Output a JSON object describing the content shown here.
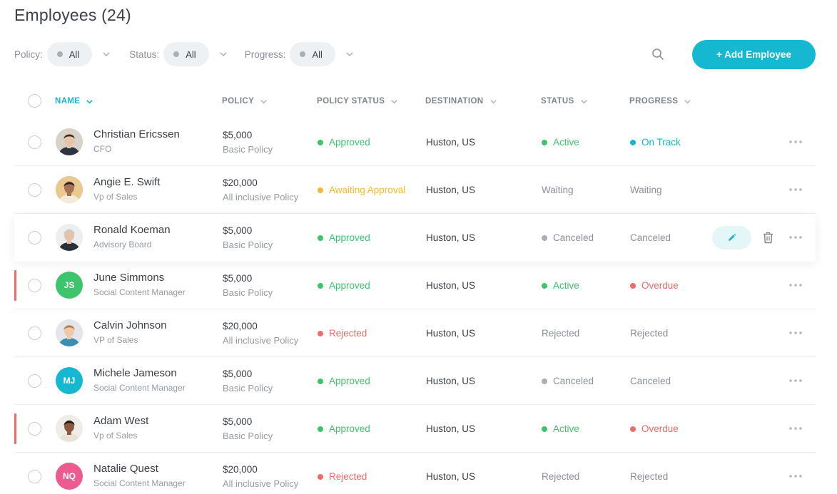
{
  "page": {
    "title": "Employees (24)"
  },
  "filters": [
    {
      "label": "Policy:",
      "value": "All"
    },
    {
      "label": "Status:",
      "value": "All"
    },
    {
      "label": "Progress:",
      "value": "All"
    }
  ],
  "actions": {
    "add_employee": "+ Add Employee",
    "search_icon": "search-icon"
  },
  "columns": [
    "NAME",
    "POLICY",
    "POLICY STATUS",
    "DESTINATION",
    "STATUS",
    "PROGRESS"
  ],
  "colors": {
    "accent": "#16b8d1",
    "green": "#3ec46d",
    "orange": "#f5b63e",
    "red": "#ef6a6a",
    "gray": "#a9afb5",
    "muted_text": "#8a9097"
  },
  "rows": [
    {
      "name": "Christian Ericssen",
      "role": "CFO",
      "amount": "$5,000",
      "policy": "Basic Policy",
      "policy_status": "Approved",
      "policy_status_color": "green",
      "destination": "Huston, US",
      "status": "Active",
      "status_dot": "green",
      "progress": "On Track",
      "progress_dot": "accent",
      "avatar": {
        "type": "photo",
        "bg": "#d9d2c8",
        "hair": "#3b2a20",
        "skin": "#e8c4a6",
        "shirt": "#2d3440"
      },
      "flag": false
    },
    {
      "name": "Angie E. Swift",
      "role": "Vp of Sales",
      "amount": "$20,000",
      "policy": "All inclusive Policy",
      "policy_status": "Awaiting Approval",
      "policy_status_color": "orange",
      "destination": "Huston, US",
      "status": "Waiting",
      "status_dot": "",
      "progress": "Waiting",
      "progress_dot": "",
      "avatar": {
        "type": "photo",
        "bg": "#e9c98f",
        "hair": "#2a1f1a",
        "skin": "#a57257",
        "shirt": "#f3ead8"
      },
      "flag": false
    },
    {
      "name": "Ronald Koeman",
      "role": "Advisory Board",
      "amount": "$5,000",
      "policy": "Basic Policy",
      "policy_status": "Approved",
      "policy_status_color": "green",
      "destination": "Huston, US",
      "status": "Canceled",
      "status_dot": "gray",
      "progress": "Canceled",
      "progress_dot": "",
      "avatar": {
        "type": "photo",
        "bg": "#eceef0",
        "hair": "#c9c9c9",
        "skin": "#e6c2aa",
        "shirt": "#2b2f38"
      },
      "flag": false,
      "hover": true
    },
    {
      "name": "June Simmons",
      "role": "Social Content Manager",
      "amount": "$5,000",
      "policy": "Basic Policy",
      "policy_status": "Approved",
      "policy_status_color": "green",
      "destination": "Huston, US",
      "status": "Active",
      "status_dot": "green",
      "progress": "Overdue",
      "progress_dot": "red",
      "avatar": {
        "type": "initials",
        "text": "JS",
        "bg": "#3ec46d"
      },
      "flag": true
    },
    {
      "name": "Calvin Johnson",
      "role": "VP of Sales",
      "amount": "$20,000",
      "policy": "All inclusive Policy",
      "policy_status": "Rejected",
      "policy_status_color": "red",
      "destination": "Huston, US",
      "status": "Rejected",
      "status_dot": "",
      "progress": "Rejected",
      "progress_dot": "",
      "avatar": {
        "type": "photo",
        "bg": "#e4e6e9",
        "hair": "#b8754a",
        "skin": "#f0c9a8",
        "shirt": "#3a8fb0"
      },
      "flag": false
    },
    {
      "name": "Michele Jameson",
      "role": "Social Content Manager",
      "amount": "$5,000",
      "policy": "Basic Policy",
      "policy_status": "Approved",
      "policy_status_color": "green",
      "destination": "Huston, US",
      "status": "Canceled",
      "status_dot": "gray",
      "progress": "Canceled",
      "progress_dot": "",
      "avatar": {
        "type": "initials",
        "text": "MJ",
        "bg": "#16b8d1"
      },
      "flag": false
    },
    {
      "name": "Adam West",
      "role": "Vp of Sales",
      "amount": "$5,000",
      "policy": "Basic Policy",
      "policy_status": "Approved",
      "policy_status_color": "green",
      "destination": "Huston, US",
      "status": "Active",
      "status_dot": "green",
      "progress": "Overdue",
      "progress_dot": "red",
      "avatar": {
        "type": "photo",
        "bg": "#f0ede8",
        "hair": "#1f1a17",
        "skin": "#8a5a40",
        "shirt": "#e8e2d8"
      },
      "flag": true
    },
    {
      "name": "Natalie Quest",
      "role": "Social Content Manager",
      "amount": "$20,000",
      "policy": "All inclusive Policy",
      "policy_status": "Rejected",
      "policy_status_color": "red",
      "destination": "Huston, US",
      "status": "Rejected",
      "status_dot": "",
      "progress": "Rejected",
      "progress_dot": "",
      "avatar": {
        "type": "initials",
        "text": "NQ",
        "bg": "#ec5b8f"
      },
      "flag": false
    }
  ]
}
